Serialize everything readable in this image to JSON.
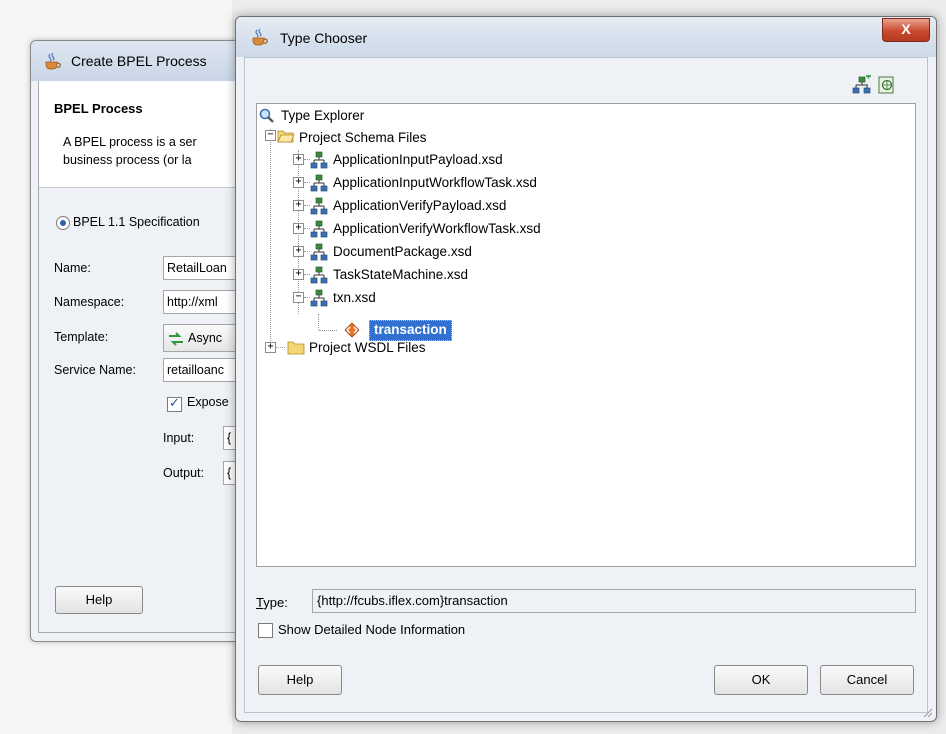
{
  "background_dialog": {
    "title": "Create BPEL Process",
    "section_title": "BPEL Process",
    "description_line1": "A BPEL process is a ser",
    "description_line2": "business process (or la",
    "spec_option": "BPEL 1.1 Specification",
    "name_label": "Name:",
    "name_value": "RetailLoan",
    "namespace_label": "Namespace:",
    "namespace_value": "http://xml",
    "template_label": "Template:",
    "template_value": "Async",
    "service_name_label": "Service Name:",
    "service_name_value": "retailloanc",
    "expose_label": "Expose",
    "expose_checked": true,
    "input_label": "Input:",
    "input_value": "{",
    "output_label": "Output:",
    "output_value": "{",
    "help_button": "Help"
  },
  "type_chooser": {
    "title": "Type Chooser",
    "close_glyph": "X",
    "tree": {
      "root": "Type Explorer",
      "schema_folder": "Project Schema Files",
      "schema_files": [
        "ApplicationInputPayload.xsd",
        "ApplicationInputWorkflowTask.xsd",
        "ApplicationVerifyPayload.xsd",
        "ApplicationVerifyWorkflowTask.xsd",
        "DocumentPackage.xsd",
        "TaskStateMachine.xsd",
        "txn.xsd"
      ],
      "selected_element": "transaction",
      "wsdl_folder": "Project WSDL Files"
    },
    "type_label": "Type:",
    "type_value": "{http://fcubs.iflex.com}transaction",
    "show_detailed_label": "Show Detailed Node Information",
    "show_detailed_checked": false,
    "help_button": "Help",
    "ok_button": "OK",
    "cancel_button": "Cancel"
  }
}
